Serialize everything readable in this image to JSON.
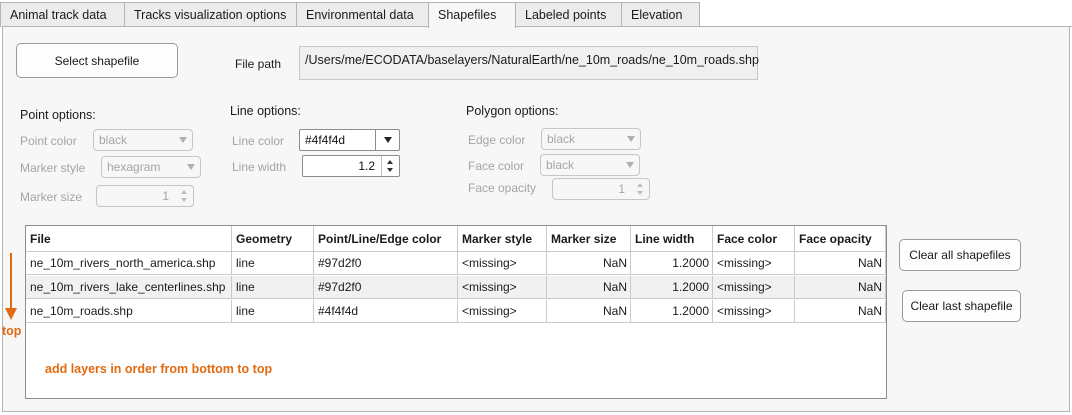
{
  "tabs": [
    {
      "label": "Animal track data"
    },
    {
      "label": "Tracks visualization options"
    },
    {
      "label": "Environmental data"
    },
    {
      "label": "Shapefiles"
    },
    {
      "label": "Labeled points"
    },
    {
      "label": "Elevation"
    }
  ],
  "active_tab": "Shapefiles",
  "select_button": "Select shapefile",
  "file_path_label": "File path",
  "file_path_value": "/Users/me/ECODATA/baselayers/NaturalEarth/ne_10m_roads/ne_10m_roads.shp",
  "point": {
    "title": "Point options:",
    "color_label": "Point color",
    "color_value": "black",
    "marker_style_label": "Marker style",
    "marker_style_value": "hexagram",
    "marker_size_label": "Marker size",
    "marker_size_value": "1"
  },
  "line": {
    "title": "Line options:",
    "color_label": "Line color",
    "color_value": "#4f4f4d",
    "width_label": "Line width",
    "width_value": "1.2"
  },
  "polygon": {
    "title": "Polygon options:",
    "edge_label": "Edge color",
    "edge_value": "black",
    "face_label": "Face color",
    "face_value": "black",
    "opacity_label": "Face opacity",
    "opacity_value": "1"
  },
  "table": {
    "columns": [
      "File",
      "Geometry",
      "Point/Line/Edge color",
      "Marker style",
      "Marker size",
      "Line width",
      "Face color",
      "Face opacity"
    ],
    "rows": [
      [
        "ne_10m_rivers_north_america.shp",
        "line",
        "#97d2f0",
        "<missing>",
        "NaN",
        "1.2000",
        "<missing>",
        "NaN"
      ],
      [
        "ne_10m_rivers_lake_centerlines.shp",
        "line",
        "#97d2f0",
        "<missing>",
        "NaN",
        "1.2000",
        "<missing>",
        "NaN"
      ],
      [
        "ne_10m_roads.shp",
        "line",
        "#4f4f4d",
        "<missing>",
        "NaN",
        "1.2000",
        "<missing>",
        "NaN"
      ]
    ]
  },
  "note": "add layers in order from bottom to top",
  "top_label": "top",
  "clear_all_button": "Clear all shapefiles",
  "clear_last_button": "Clear last shapefile",
  "colors": {
    "annotation": "#e16a12",
    "panel_bg": "#f7f7f7",
    "disabled_text": "#a4a4a4"
  },
  "icons": [
    "dropdown-arrow-icon",
    "spinner-up-icon",
    "spinner-down-icon",
    "down-arrow-icon"
  ]
}
